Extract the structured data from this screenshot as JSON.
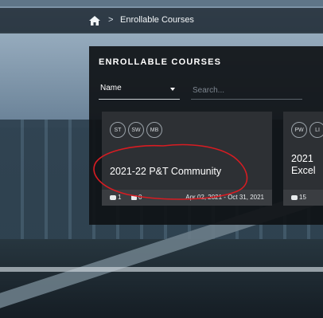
{
  "breadcrumb": {
    "home_icon": "home-icon",
    "separator": ">",
    "current": "Enrollable Courses"
  },
  "panel": {
    "title": "ENROLLABLE COURSES",
    "sort_select": {
      "value": "Name"
    },
    "search": {
      "placeholder": "Search..."
    }
  },
  "cards": [
    {
      "tags": [
        "ST",
        "SW",
        "MB"
      ],
      "title": "2021-22 P&T Community",
      "users": "1",
      "documents": "0",
      "dates": "Apr 02, 2021 - Oct 31, 2021"
    },
    {
      "tags": [
        "PW",
        "LI"
      ],
      "title_line1": "2021",
      "title_line2": "Excel",
      "users": "15"
    }
  ],
  "colors": {
    "annotation": "#d81c22",
    "panel_bg": "#0f1216",
    "card_bg": "#2d3034"
  }
}
